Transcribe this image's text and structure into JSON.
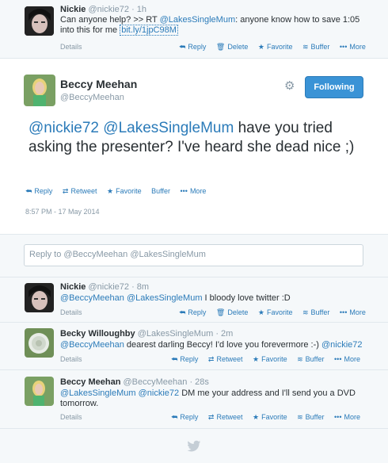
{
  "top_tweet": {
    "name": "Nickie",
    "handle": "@nickie72",
    "time": "· 1h",
    "line1_prefix": "Can anyone help? >> RT ",
    "line1_mention": "@LakesSingleMum",
    "line1_suffix": ": anyone know how to save 1:05",
    "line2_prefix": "into this for me ",
    "line2_link": "bit.ly/1jpC98M",
    "details": "Details",
    "reply": "Reply",
    "delete": "Delete",
    "favorite": "Favorite",
    "buffer": "Buffer",
    "more": "More"
  },
  "main_tweet": {
    "name": "Beccy Meehan",
    "handle": "@BeccyMeehan",
    "follow_label": "Following",
    "mention1": "@nickie72",
    "mention2": "@LakesSingleMum",
    "text_rest": " have you tried asking the presenter? I've heard she dead nice ;)",
    "reply": "Reply",
    "retweet": "Retweet",
    "favorite": "Favorite",
    "buffer": "Buffer",
    "more": "More",
    "timestamp": "8:57 PM - 17 May 2014"
  },
  "reply_box": {
    "placeholder": "Reply to @BeccyMeehan @LakesSingleMum"
  },
  "replies": [
    {
      "name": "Nickie",
      "handle": "@nickie72",
      "time": "· 8m",
      "mention1": "@BeccyMeehan",
      "mention2": "@LakesSingleMum",
      "text": " I bloody love twitter :D",
      "details": "Details",
      "a1": "Reply",
      "a2": "Delete",
      "a3": "Favorite",
      "a4": "Buffer",
      "a5": "More"
    },
    {
      "name": "Becky Willoughby",
      "handle": "@LakesSingleMum",
      "time": "· 2m",
      "mention1": "@BeccyMeehan",
      "text": " dearest darling Beccy! I'd love you forevermore :-) ",
      "mention2": "@nickie72",
      "details": "Details",
      "a1": "Reply",
      "a2": "Retweet",
      "a3": "Favorite",
      "a4": "Buffer",
      "a5": "More"
    },
    {
      "name": "Beccy Meehan",
      "handle": "@BeccyMeehan",
      "time": "· 28s",
      "mention1": "@LakesSingleMum",
      "mention2": "@nickie72",
      "text": " DM me your address and I'll send you a DVD",
      "text2": "tomorrow.",
      "details": "Details",
      "a1": "Reply",
      "a2": "Retweet",
      "a3": "Favorite",
      "a4": "Buffer",
      "a5": "More"
    }
  ],
  "icons": {
    "reply": "reply-arrow-icon",
    "delete": "trash-icon",
    "favorite": "star-icon",
    "buffer": "buffer-stack-icon",
    "more": "ellipsis-icon",
    "retweet": "retweet-icon",
    "settings": "gear-icon",
    "bird": "twitter-bird-icon"
  },
  "colors": {
    "link": "#2b7bb9",
    "follow_button": "#3a93d6",
    "muted": "#8899a6",
    "background": "#f5f8fa"
  }
}
